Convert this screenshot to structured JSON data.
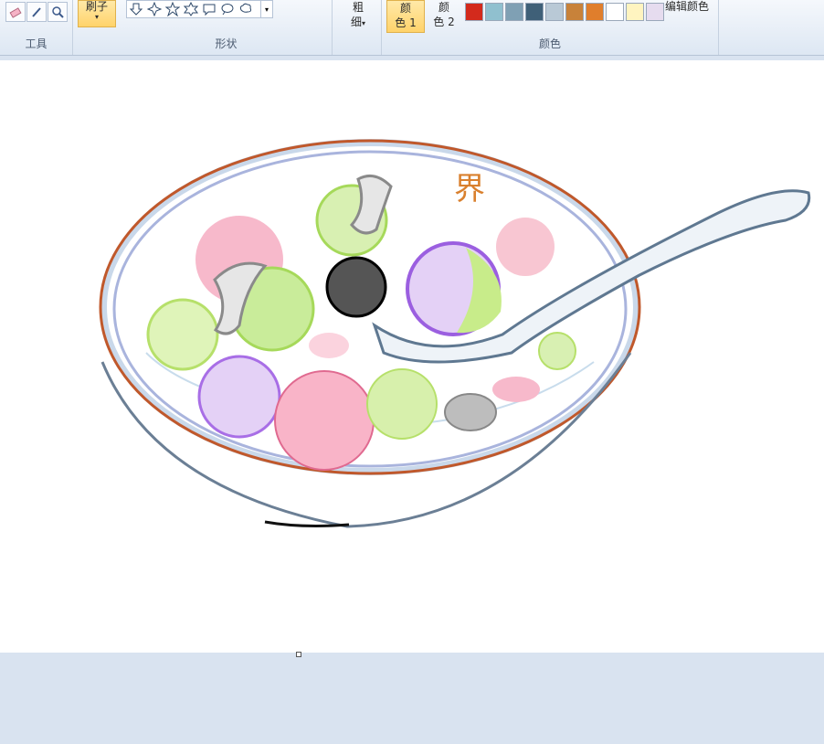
{
  "ribbon": {
    "tools_label": "工具",
    "brush_label": "刷子",
    "shapes_label": "形状",
    "size_label_line1": "粗",
    "size_label_line2": "细",
    "color1_line1": "颜",
    "color1_line2": "色 1",
    "color2_line1": "颜",
    "color2_line2": "色 2",
    "colors_label": "颜色",
    "edit_colors": "编辑颜色",
    "dropdown_glyph": "▾"
  },
  "palette": [
    "#d32a1c",
    "#90c0cf",
    "#7fa0b4",
    "#3f6078",
    "#b9c9d6",
    "#c8823a",
    "#e07e2c",
    "#ffffff",
    "#fff4c0",
    "#e6dcef"
  ],
  "canvas": {
    "drawing_text": "界"
  }
}
